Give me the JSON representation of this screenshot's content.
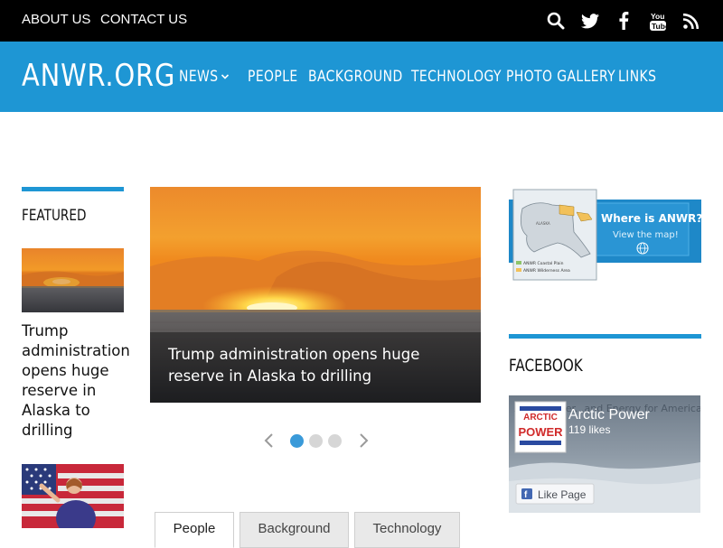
{
  "top_bar": {
    "links": [
      "ABOUT US",
      "CONTACT US"
    ],
    "social_icons": [
      "search-icon",
      "twitter-icon",
      "facebook-icon",
      "youtube-icon",
      "rss-icon"
    ]
  },
  "header": {
    "logo": "ANWR.ORG",
    "nav": [
      "NEWS",
      "PEOPLE",
      "BACKGROUND",
      "TECHNOLOGY",
      "PHOTO GALLERY",
      "LINKS"
    ]
  },
  "featured": {
    "title": "FEATURED",
    "article_title": "Trump administration opens huge reserve in Alaska to drilling"
  },
  "slider": {
    "caption": "Trump administration opens huge reserve in Alaska to drilling",
    "slide_count": 3,
    "active_index": 0
  },
  "tabs": [
    "People",
    "Background",
    "Technology"
  ],
  "active_tab": 0,
  "sidebar": {
    "map_banner": {
      "title": "Where is ANWR?",
      "subtitle": "View the map!",
      "legend": [
        "ANWR Coastal Plain",
        "ANWR Wilderness Area"
      ]
    },
    "facebook_title": "FACEBOOK",
    "facebook_widget": {
      "page_name": "Arctic Power",
      "likes": "119 likes",
      "like_button": "Like Page",
      "cover_text": "Arctic Power...and Energy for America",
      "logo_top": "ARCTIC",
      "logo_bottom": "POWER"
    }
  },
  "colors": {
    "accent": "#1e96d4",
    "top_bar": "#000000",
    "dot_active": "#3a9ad9"
  }
}
